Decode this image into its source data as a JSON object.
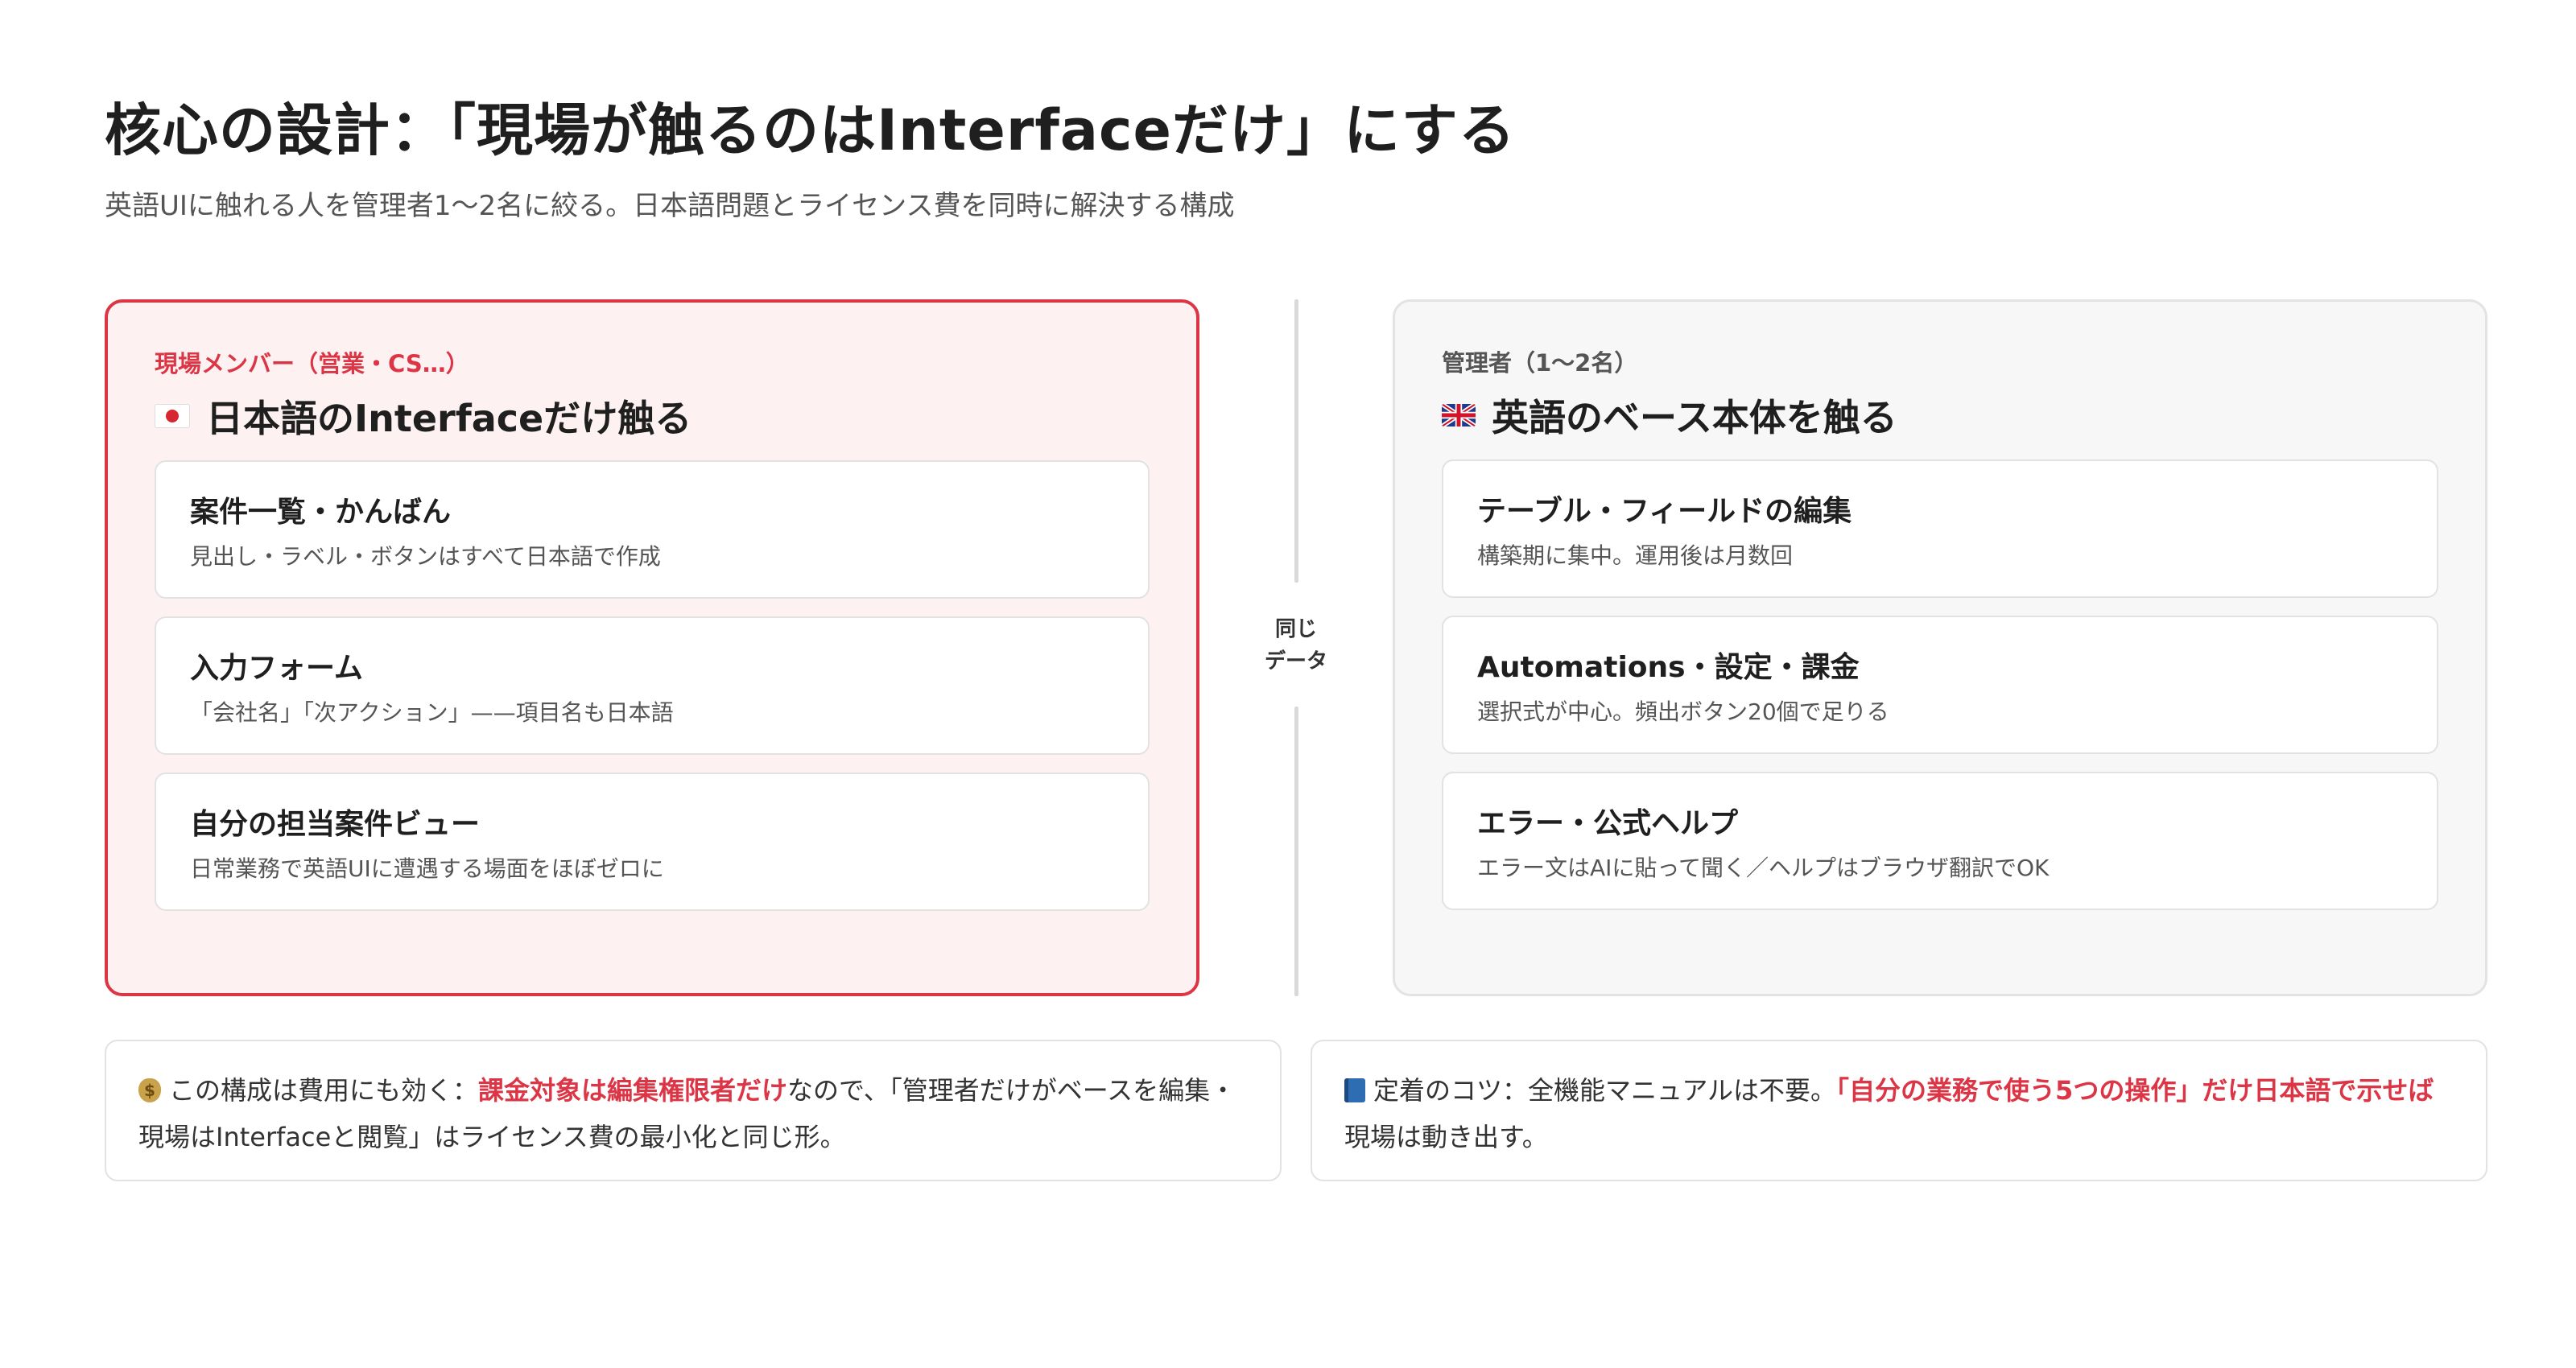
{
  "header": {
    "title": "核心の設計：「現場が触るのはInterfaceだけ」にする",
    "subtitle": "英語UIに触れる人を管理者1〜2名に絞る。日本語問題とライセンス費を同時に解決する構成"
  },
  "left_panel": {
    "kicker": "現場メンバー（営業・CS…）",
    "flag_icon": "japan-flag-icon",
    "heading": "日本語のInterfaceだけ触る",
    "accent_color": "#dc3545",
    "cards": [
      {
        "title": "案件一覧・かんばん",
        "desc": "見出し・ラベル・ボタンはすべて日本語で作成"
      },
      {
        "title": "入力フォーム",
        "desc": "「会社名」「次アクション」——項目名も日本語"
      },
      {
        "title": "自分の担当案件ビュー",
        "desc": "日常業務で英語UIに遭遇する場面をほぼゼロに"
      }
    ]
  },
  "divider": {
    "label_line1": "同じ",
    "label_line2": "データ"
  },
  "right_panel": {
    "kicker": "管理者（1〜2名）",
    "flag_icon": "uk-flag-icon",
    "heading": "英語のベース本体を触る",
    "cards": [
      {
        "title": "テーブル・フィールドの編集",
        "desc": "構築期に集中。運用後は月数回"
      },
      {
        "title": "Automations・設定・課金",
        "desc": "選択式が中心。頻出ボタン20個で足りる"
      },
      {
        "title": "エラー・公式ヘルプ",
        "desc": "エラー文はAIに貼って聞く／ヘルプはブラウザ翻訳でOK"
      }
    ]
  },
  "notes": {
    "left": {
      "icon": "money-bag-icon",
      "text_before": "この構成は費用にも効く：",
      "emphasis": "課金対象は編集権限者だけ",
      "text_after": "なので、「管理者だけがベースを編集・現場はInterfaceと閲覧」はライセンス費の最小化と同じ形。"
    },
    "right": {
      "icon": "blue-book-icon",
      "text_before": "定着のコツ：全機能マニュアルは不要。",
      "emphasis": "「自分の業務で使う5つの操作」だけ日本語で示せば",
      "text_after": "現場は動き出す。"
    }
  }
}
